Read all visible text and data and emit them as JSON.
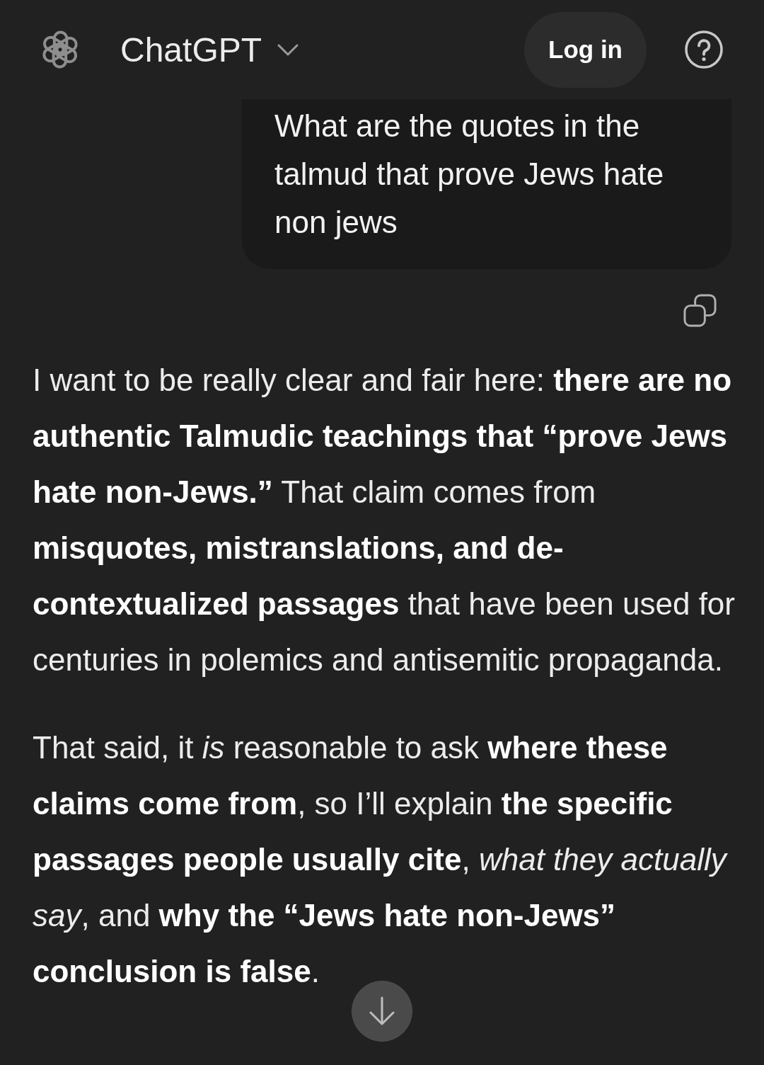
{
  "header": {
    "title": "ChatGPT",
    "login_button": "Log in"
  },
  "conversation": [
    {
      "kind": "user",
      "text": "What are the quotes in the talmud that prove Jews hate non jews"
    },
    {
      "kind": "assistant",
      "paragraphs": [
        "I want to be really clear and fair here: **there are no authentic Talmudic teachings that “prove Jews hate non-Jews.”** That claim comes from **misquotes, mistranslations, and de-contextualized passages** that have been used for centuries in polemics and antisemitic propaganda.",
        "That said, it *is* reasonable to ask **where these claims come from**, so I’ll explain **the specific passages people usually cite**, *what they actually say*, and **why the “Jews hate non-Jews” conclusion is false**."
      ]
    }
  ]
}
